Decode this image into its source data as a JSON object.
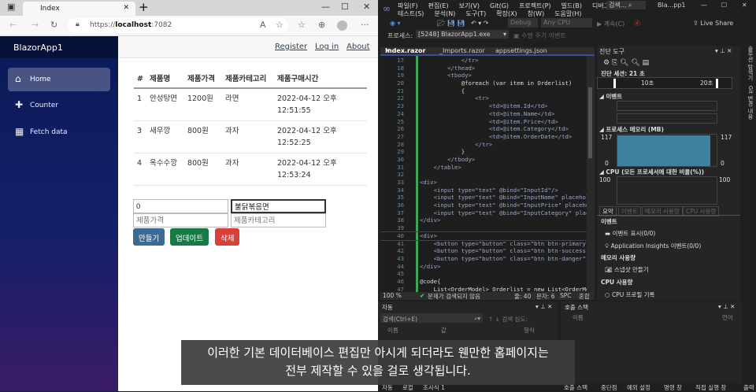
{
  "browser": {
    "tab_title": "Index",
    "url_prefix": "https://",
    "url_host": "localhost",
    "url_port": ":7082"
  },
  "app": {
    "brand": "BlazorApp1",
    "nav": [
      {
        "label": "Home",
        "icon": "home-icon"
      },
      {
        "label": "Counter",
        "icon": "plus-icon"
      },
      {
        "label": "Fetch data",
        "icon": "list-icon"
      }
    ],
    "top_links": [
      "Register",
      "Log in",
      "About"
    ],
    "table": {
      "headers": [
        "#",
        "제품명",
        "제품가격",
        "제품카테고리",
        "제품구매시간"
      ],
      "rows": [
        [
          "1",
          "안성탕면",
          "1200원",
          "라면",
          "2022-04-12 오후 12:51:55"
        ],
        [
          "3",
          "새우깡",
          "800원",
          "과자",
          "2022-04-12 오후 12:52:25"
        ],
        [
          "4",
          "옥수수깡",
          "800원",
          "과자",
          "2022-04-12 오후 12:53:24"
        ]
      ]
    },
    "form": {
      "id_value": "0",
      "name_value": "불닭볶음면",
      "price_placeholder": "제품가격",
      "category_placeholder": "제품카테고리"
    },
    "buttons": {
      "create": "만들기",
      "update": "업데이트",
      "delete": "삭제"
    }
  },
  "vs": {
    "menu1": [
      "파일(F)",
      "편집(E)",
      "보기(V)",
      "Git(G)",
      "프로젝트(P)",
      "빌드(B)",
      "디버그(D)"
    ],
    "menu2": [
      "테스트(S)",
      "분석(N)",
      "도구(T)",
      "확장(X)",
      "창(W)",
      "도움말(H)"
    ],
    "search": "검색...",
    "title": "Bla...pp1",
    "debug": "Debug",
    "cpu": "Any CPU",
    "continue": "계속(C)",
    "live_share": "Live Share",
    "process_label": "프로세스:",
    "process": "[5248] BlazorApp1.exe",
    "lifecycle": "수명 주기 이벤트",
    "tabs": [
      "Index.razor",
      "_Imports.razor",
      "appsettings.json"
    ],
    "code": [
      [
        "17",
        "            </tr>"
      ],
      [
        "18",
        "        </thead>"
      ],
      [
        "19",
        "        <tbody>"
      ],
      [
        "20",
        "            @foreach (var item in Orderlist)"
      ],
      [
        "21",
        "            {"
      ],
      [
        "22",
        "                <tr>"
      ],
      [
        "23",
        "                    <td>@item.Id</td>"
      ],
      [
        "24",
        "                    <td>@item.Name</td>"
      ],
      [
        "25",
        "                    <td>@item.Price</td>"
      ],
      [
        "26",
        "                    <td>@item.Category</td>"
      ],
      [
        "27",
        "                    <td>@item.OrderDate</td>"
      ],
      [
        "28",
        "                </tr>"
      ],
      [
        "29",
        "            }"
      ],
      [
        "30",
        "        </tbody>"
      ],
      [
        "31",
        "    </table>"
      ],
      [
        "32",
        ""
      ],
      [
        "33",
        "<div>"
      ],
      [
        "34",
        "    <input type=\"text\" @bind=\"InputId\"/>"
      ],
      [
        "35",
        "    <input type=\"text\" @bind=\"InputName\" placehol"
      ],
      [
        "36",
        "    <input type=\"text\" @bind=\"InputPrice\" placeho"
      ],
      [
        "37",
        "    <input type=\"text\" @bind=\"InputCategory\" plac"
      ],
      [
        "38",
        "</div>"
      ],
      [
        "39",
        ""
      ],
      [
        "40",
        "<div>"
      ],
      [
        "41",
        "    <button type=\"button\" class=\"btn btn-primary\""
      ],
      [
        "42",
        "    <button type=\"button\" class=\"btn btn-success\""
      ],
      [
        "43",
        "    <button type=\"button\" class=\"btn btn-danger\""
      ],
      [
        "44",
        "</div>"
      ],
      [
        "45",
        ""
      ],
      [
        "46",
        "@code{"
      ],
      [
        "47",
        "    List<OrderModel> Orderlist = new List<OrderMo"
      ]
    ],
    "status": {
      "zoom": "100 %",
      "issues": "문제가 검색되지 않음",
      "line": "줄: 40",
      "col": "문자: 6",
      "spc": "SPC",
      "crlf": "혼합"
    },
    "diag": {
      "title": "진단 도구",
      "session": "진단 세션: 21 초",
      "t10": "10초",
      "t20": "20초",
      "events": "이벤트",
      "memory": "프로세스 메모리 (MB)",
      "mem_max": "117",
      "mem_min": "0",
      "cpu": "CPU (모든 프로세서에 대한 비율(%))",
      "cpu_max": "100",
      "tabs": [
        "요약",
        "이벤트",
        "메모리 사용량",
        "CPU 사용량"
      ],
      "s_events": "이벤트",
      "show_events": "이벤트 표시(0/0)",
      "ai_events": "Application Insights 이벤트(0/0)",
      "s_mem": "메모리 사용량",
      "snapshot": "스냅샷 만들기",
      "s_cpu": "CPU 사용량",
      "cpu_profile": "CPU 프로필 기록",
      "mem_fill": 0.97
    },
    "auto": {
      "title": "자동",
      "search": "검색(Ctrl+E)",
      "depth": "검색 심도:",
      "cols": [
        "이름",
        "값",
        "형식"
      ],
      "tabs": [
        "자동",
        "로컬",
        "조사식 1"
      ]
    },
    "callstack": {
      "title": "호출 스택",
      "cols": [
        "이름",
        "언어"
      ],
      "tabs": [
        "호출 스택",
        "중단점",
        "예외 설정",
        "명령 창",
        "직접 실행 창",
        "출력"
      ]
    },
    "side_tabs": [
      "솔루션 탐색기",
      "Git 변경 내용"
    ]
  },
  "subtitle": {
    "line1": "이러한 기본 데이터베이스 편집만 아시게 되더라도 웬만한 홈페이지는",
    "line2": "전부 제작할 수 있을 걸로 생각됩니다."
  }
}
